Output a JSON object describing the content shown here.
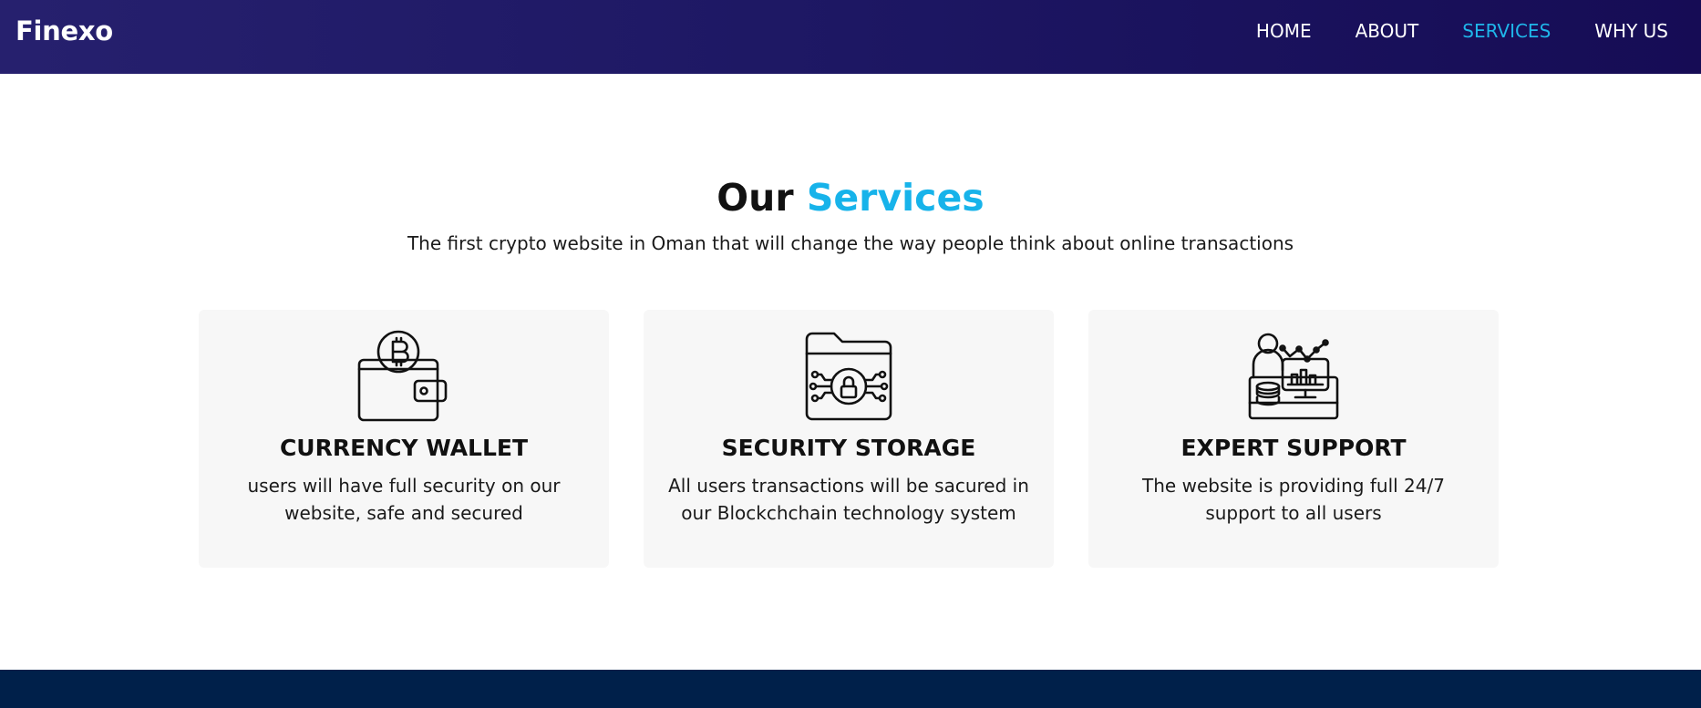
{
  "nav": {
    "brand": "Finexo",
    "links": [
      {
        "label": "HOME",
        "active": false
      },
      {
        "label": "ABOUT",
        "active": false
      },
      {
        "label": "SERVICES",
        "active": true
      },
      {
        "label": "WHY US",
        "active": false
      }
    ]
  },
  "services": {
    "title_prefix": "Our",
    "title_accent": "Services",
    "subtitle": "The first crypto website in Oman that will change the way people think about online transactions",
    "cards": [
      {
        "icon": "bitcoin-wallet-icon",
        "title": "CURRENCY WALLET",
        "text": "users will have full security on our website, safe and secured"
      },
      {
        "icon": "secure-folder-icon",
        "title": "SECURITY STORAGE",
        "text": "All users transactions will be sacured in our Blockchchain technology system"
      },
      {
        "icon": "expert-support-icon",
        "title": "EXPERT SUPPORT",
        "text": "The website is providing full 24/7 support to all users"
      }
    ]
  },
  "colors": {
    "accent": "#17b3ea",
    "nav_bg_start": "#26206e",
    "nav_bg_end": "#160c55",
    "card_bg": "#f7f7f7",
    "footer_bg": "#00204a"
  }
}
